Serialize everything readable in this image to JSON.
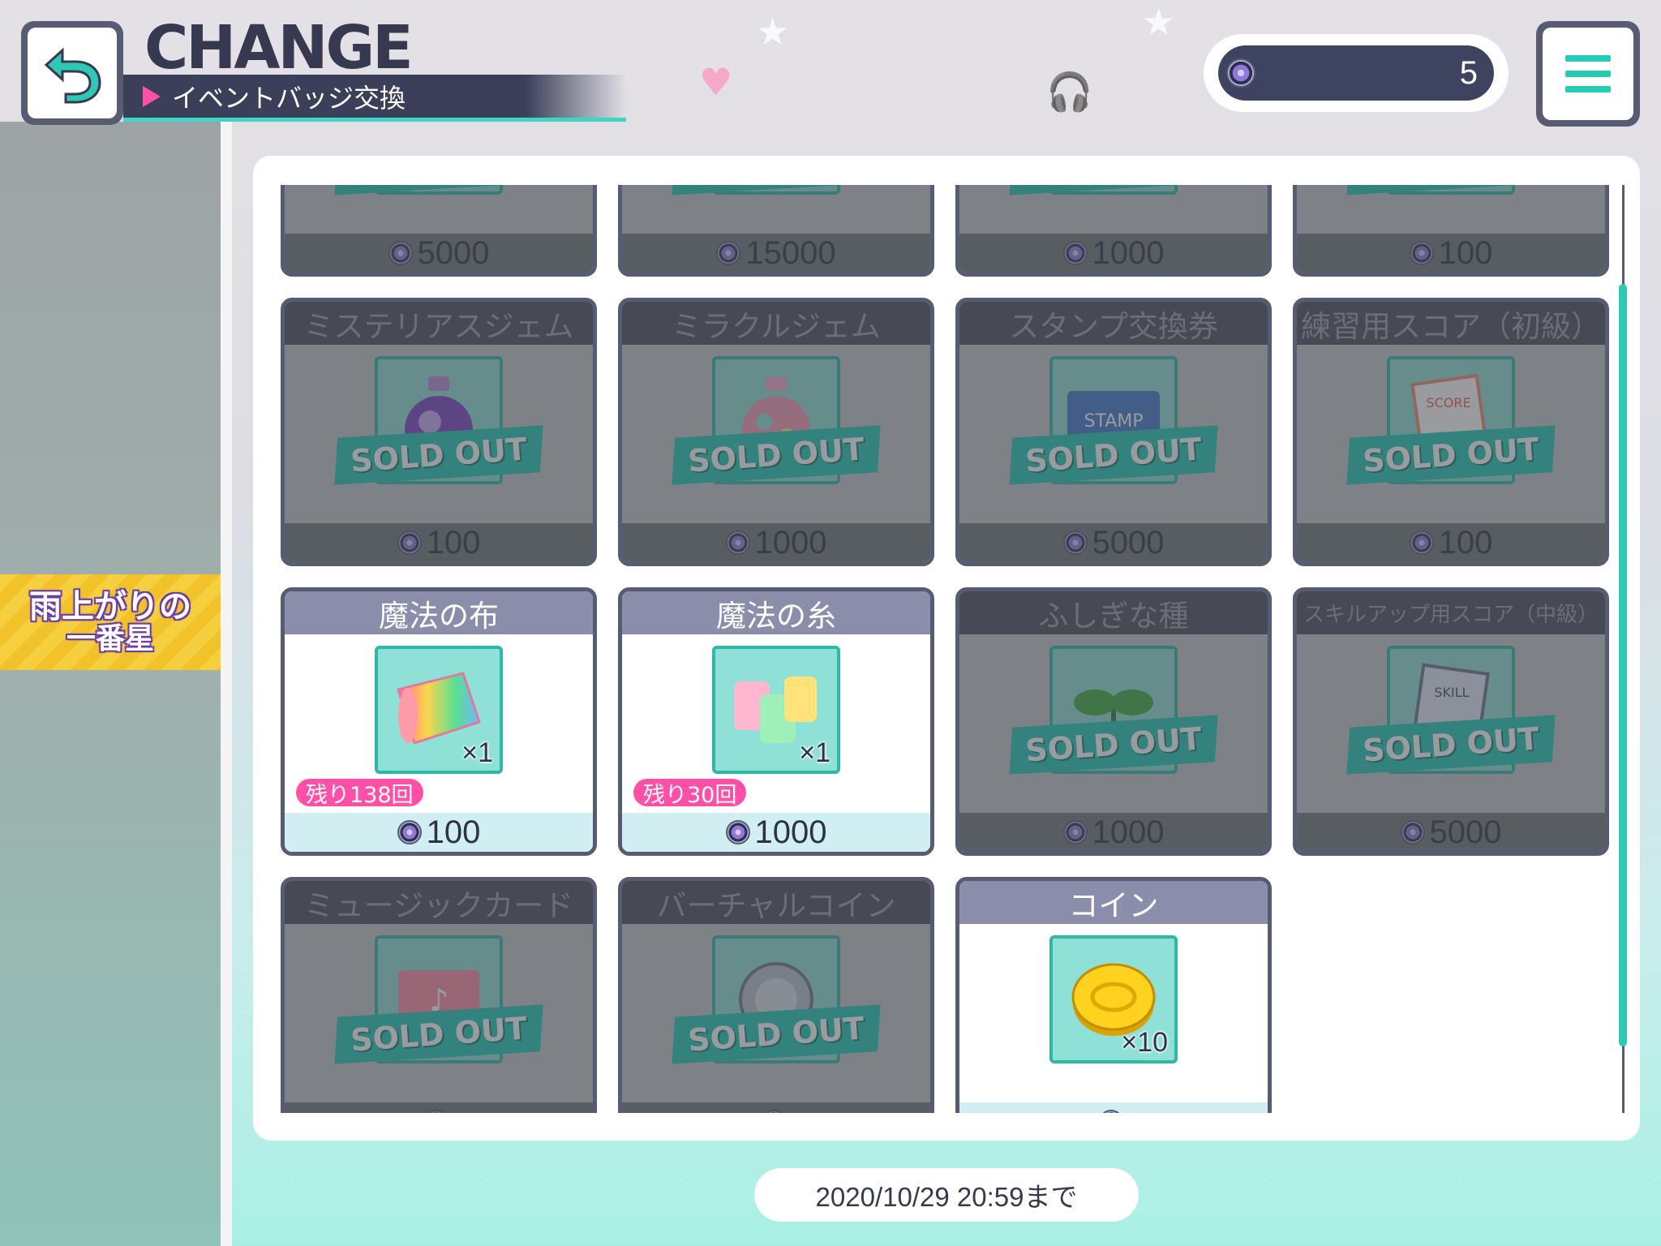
{
  "header": {
    "title": "CHANGE",
    "subtitle": "イベントバッジ交換",
    "badge_count": "5"
  },
  "side_banner": {
    "line1": "雨上がりの",
    "line2": "一番星"
  },
  "sold_out_label": "SOLD OUT",
  "items": [
    {
      "name": "",
      "icon": "item-icon",
      "price": "5000",
      "sold_out": true
    },
    {
      "name": "",
      "icon": "item-icon",
      "price": "15000",
      "sold_out": true
    },
    {
      "name": "",
      "icon": "item-icon",
      "price": "1000",
      "sold_out": true
    },
    {
      "name": "",
      "icon": "item-icon",
      "price": "100",
      "sold_out": true
    },
    {
      "name": "ミステリアスジェム",
      "icon": "mysterious-gem-icon",
      "price": "100",
      "sold_out": true
    },
    {
      "name": "ミラクルジェム",
      "icon": "miracle-gem-icon",
      "price": "1000",
      "sold_out": true
    },
    {
      "name": "スタンプ交換券",
      "icon": "stamp-ticket-icon",
      "price": "5000",
      "sold_out": true
    },
    {
      "name": "練習用スコア（初級）",
      "icon": "practice-score-icon",
      "price": "100",
      "sold_out": true
    },
    {
      "name": "魔法の布",
      "icon": "magic-cloth-icon",
      "qty": "×1",
      "remaining": "残り138回",
      "price": "100",
      "sold_out": false
    },
    {
      "name": "魔法の糸",
      "icon": "magic-thread-icon",
      "qty": "×1",
      "remaining": "残り30回",
      "price": "1000",
      "sold_out": false
    },
    {
      "name": "ふしぎな種",
      "icon": "mysterious-seed-icon",
      "price": "1000",
      "sold_out": true
    },
    {
      "name": "スキルアップ用スコア（中級）",
      "icon": "skill-score-icon",
      "price": "5000",
      "sold_out": true
    },
    {
      "name": "ミュージックカード",
      "icon": "music-card-icon",
      "price": "",
      "sold_out": true
    },
    {
      "name": "バーチャルコイン",
      "icon": "virtual-coin-icon",
      "price": "",
      "sold_out": true
    },
    {
      "name": "コイン",
      "icon": "coin-icon",
      "qty": "×10",
      "price": "",
      "sold_out": false
    }
  ],
  "deadline": "2020/10/29 20:59まで",
  "colors": {
    "accent": "#2ec8b4",
    "dark": "#3b3f59",
    "pink": "#ff4fa6"
  }
}
